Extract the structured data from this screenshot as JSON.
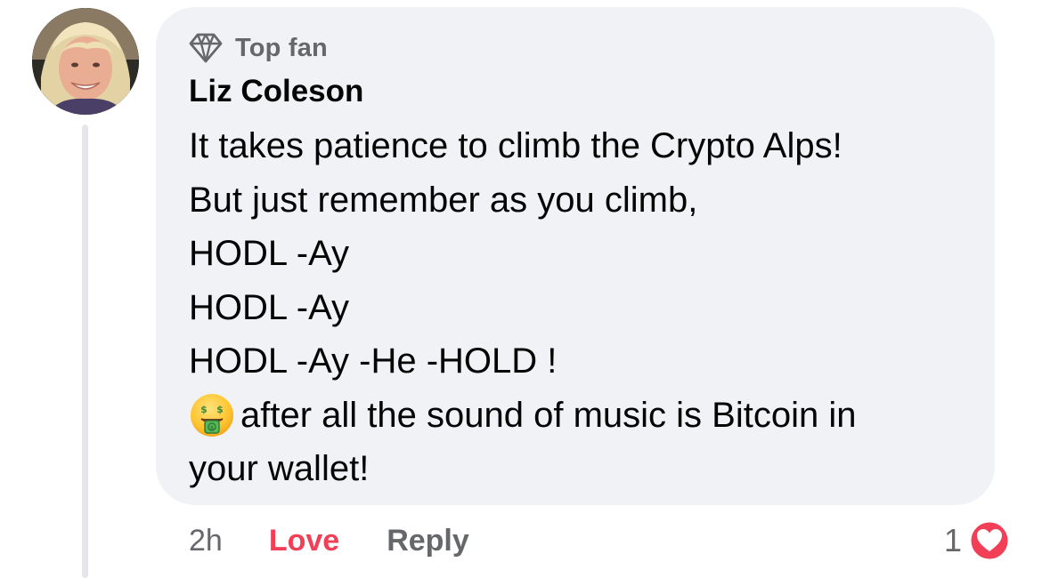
{
  "comment": {
    "badge_label": "Top fan",
    "badge_icon": "diamond-icon",
    "author": "Liz Coleson",
    "lines": [
      "It takes patience to climb the Crypto Alps!",
      "But just remember as you climb,",
      "HODL -Ay",
      "HODL -Ay",
      "HODL -Ay -He -HOLD !"
    ],
    "emoji_icon": "money-mouth-face-icon",
    "emoji_line_text": "after all the sound of music is Bitcoin in",
    "last_line": "your wallet!"
  },
  "footer": {
    "time": "2h",
    "love_label": "Love",
    "reply_label": "Reply"
  },
  "reaction": {
    "count": "1",
    "icon": "heart-reaction-icon",
    "color": "#f33e58"
  },
  "colors": {
    "bubble": "#f0f2f5",
    "secondary_text": "#65676b",
    "love": "#f33e58",
    "thread_line": "#e4e6ea"
  }
}
